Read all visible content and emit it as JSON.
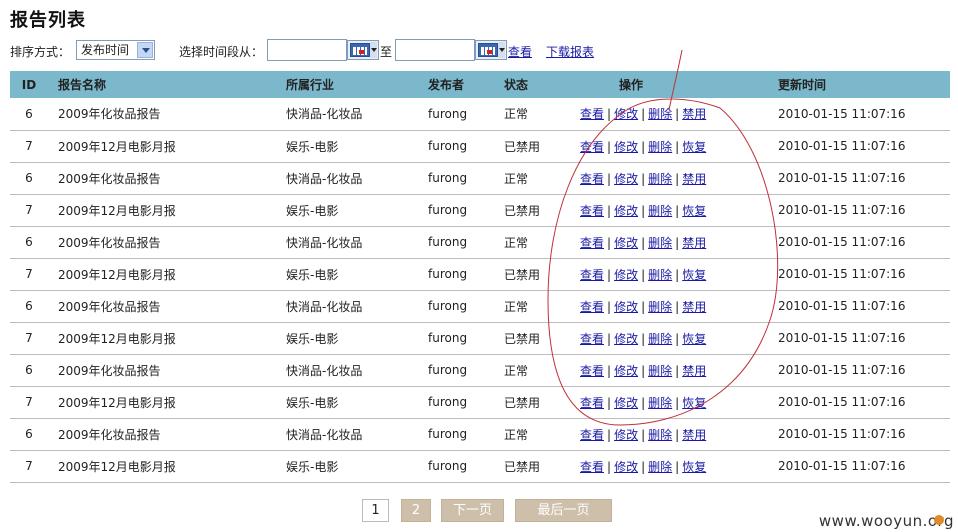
{
  "page_title": "报告列表",
  "filters": {
    "sort_label": "排序方式：",
    "sort_selected": "发布时间",
    "date_range_label": "选择时间段从：",
    "date_from_value": "",
    "to_label": "至",
    "date_to_value": "",
    "view_link": "查看",
    "download_link": "下载报表"
  },
  "table": {
    "columns": [
      "ID",
      "报告名称",
      "所属行业",
      "发布者",
      "状态",
      "操作",
      "更新时间"
    ],
    "actions_enabled": [
      "查看",
      "修改",
      "删除",
      "禁用"
    ],
    "actions_disabled": [
      "查看",
      "修改",
      "删除",
      "恢复"
    ],
    "rows": [
      {
        "id": "6",
        "name": "2009年化妆品报告",
        "industry": "快消品-化妆品",
        "publisher": "furong",
        "status": "正常",
        "action4": "禁用",
        "updated": "2010-01-15 11:07:16"
      },
      {
        "id": "7",
        "name": "2009年12月电影月报",
        "industry": "娱乐-电影",
        "publisher": "furong",
        "status": "已禁用",
        "action4": "恢复",
        "updated": "2010-01-15 11:07:16"
      },
      {
        "id": "6",
        "name": "2009年化妆品报告",
        "industry": "快消品-化妆品",
        "publisher": "furong",
        "status": "正常",
        "action4": "禁用",
        "updated": "2010-01-15 11:07:16"
      },
      {
        "id": "7",
        "name": "2009年12月电影月报",
        "industry": "娱乐-电影",
        "publisher": "furong",
        "status": "已禁用",
        "action4": "恢复",
        "updated": "2010-01-15 11:07:16"
      },
      {
        "id": "6",
        "name": "2009年化妆品报告",
        "industry": "快消品-化妆品",
        "publisher": "furong",
        "status": "正常",
        "action4": "禁用",
        "updated": "2010-01-15 11:07:16"
      },
      {
        "id": "7",
        "name": "2009年12月电影月报",
        "industry": "娱乐-电影",
        "publisher": "furong",
        "status": "已禁用",
        "action4": "恢复",
        "updated": "2010-01-15 11:07:16"
      },
      {
        "id": "6",
        "name": "2009年化妆品报告",
        "industry": "快消品-化妆品",
        "publisher": "furong",
        "status": "正常",
        "action4": "禁用",
        "updated": "2010-01-15 11:07:16"
      },
      {
        "id": "7",
        "name": "2009年12月电影月报",
        "industry": "娱乐-电影",
        "publisher": "furong",
        "status": "已禁用",
        "action4": "恢复",
        "updated": "2010-01-15 11:07:16"
      },
      {
        "id": "6",
        "name": "2009年化妆品报告",
        "industry": "快消品-化妆品",
        "publisher": "furong",
        "status": "正常",
        "action4": "禁用",
        "updated": "2010-01-15 11:07:16"
      },
      {
        "id": "7",
        "name": "2009年12月电影月报",
        "industry": "娱乐-电影",
        "publisher": "furong",
        "status": "已禁用",
        "action4": "恢复",
        "updated": "2010-01-15 11:07:16"
      },
      {
        "id": "6",
        "name": "2009年化妆品报告",
        "industry": "快消品-化妆品",
        "publisher": "furong",
        "status": "正常",
        "action4": "禁用",
        "updated": "2010-01-15 11:07:16"
      },
      {
        "id": "7",
        "name": "2009年12月电影月报",
        "industry": "娱乐-电影",
        "publisher": "furong",
        "status": "已禁用",
        "action4": "恢复",
        "updated": "2010-01-15 11:07:16"
      }
    ]
  },
  "pagination": {
    "current": "1",
    "page2": "2",
    "next": "下一页",
    "last": "最后一页"
  },
  "watermark": "www.wooyun.org",
  "colors": {
    "header_bg": "#7bb8cc",
    "link": "#1a1aa6",
    "pager_btn": "#cdbfa9",
    "annotation": "#c0303a"
  },
  "icons": [
    "chevron-down-icon",
    "calendar-icon"
  ]
}
